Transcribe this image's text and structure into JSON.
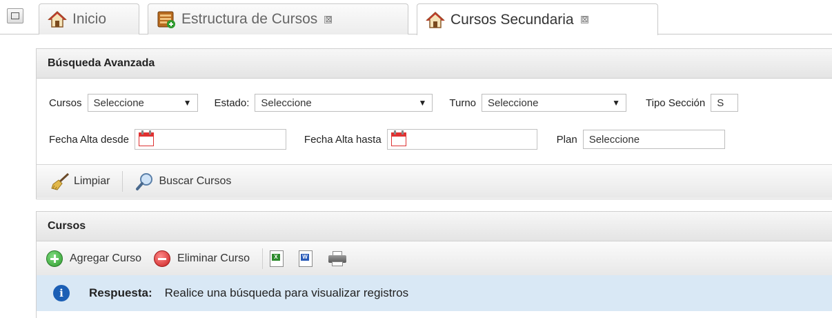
{
  "tabs": [
    {
      "label": "Inicio",
      "icon": "home-icon",
      "closable": false
    },
    {
      "label": "Estructura de Cursos",
      "icon": "structure-icon",
      "closable": true
    },
    {
      "label": "Cursos Secundaria",
      "icon": "home-icon",
      "closable": true,
      "active": true
    }
  ],
  "close_glyph": "⊠",
  "search_panel": {
    "title": "Búsqueda Avanzada",
    "cursos_label": "Cursos",
    "cursos_value": "Seleccione",
    "estado_label": "Estado:",
    "estado_value": "Seleccione",
    "turno_label": "Turno",
    "turno_value": "Seleccione",
    "tipo_seccion_label": "Tipo Sección",
    "tipo_seccion_value": "S",
    "fecha_desde_label": "Fecha Alta desde",
    "fecha_hasta_label": "Fecha Alta hasta",
    "plan_label": "Plan",
    "plan_value": "Seleccione",
    "caret": "▼",
    "limpiar_label": "Limpiar",
    "buscar_label": "Buscar Cursos"
  },
  "cursos_panel": {
    "title": "Cursos",
    "agregar_label": "Agregar Curso",
    "eliminar_label": "Eliminar Curso",
    "excel_glyph": "X",
    "word_glyph": "W",
    "info_glyph": "i",
    "respuesta_label": "Respuesta:",
    "respuesta_text": "Realice una búsqueda para visualizar registros"
  },
  "colors": {
    "info_bg": "#d9e8f5",
    "info_icon": "#1c5fb5",
    "add_green": "#2e9a2e",
    "delete_red": "#c91f1f"
  }
}
